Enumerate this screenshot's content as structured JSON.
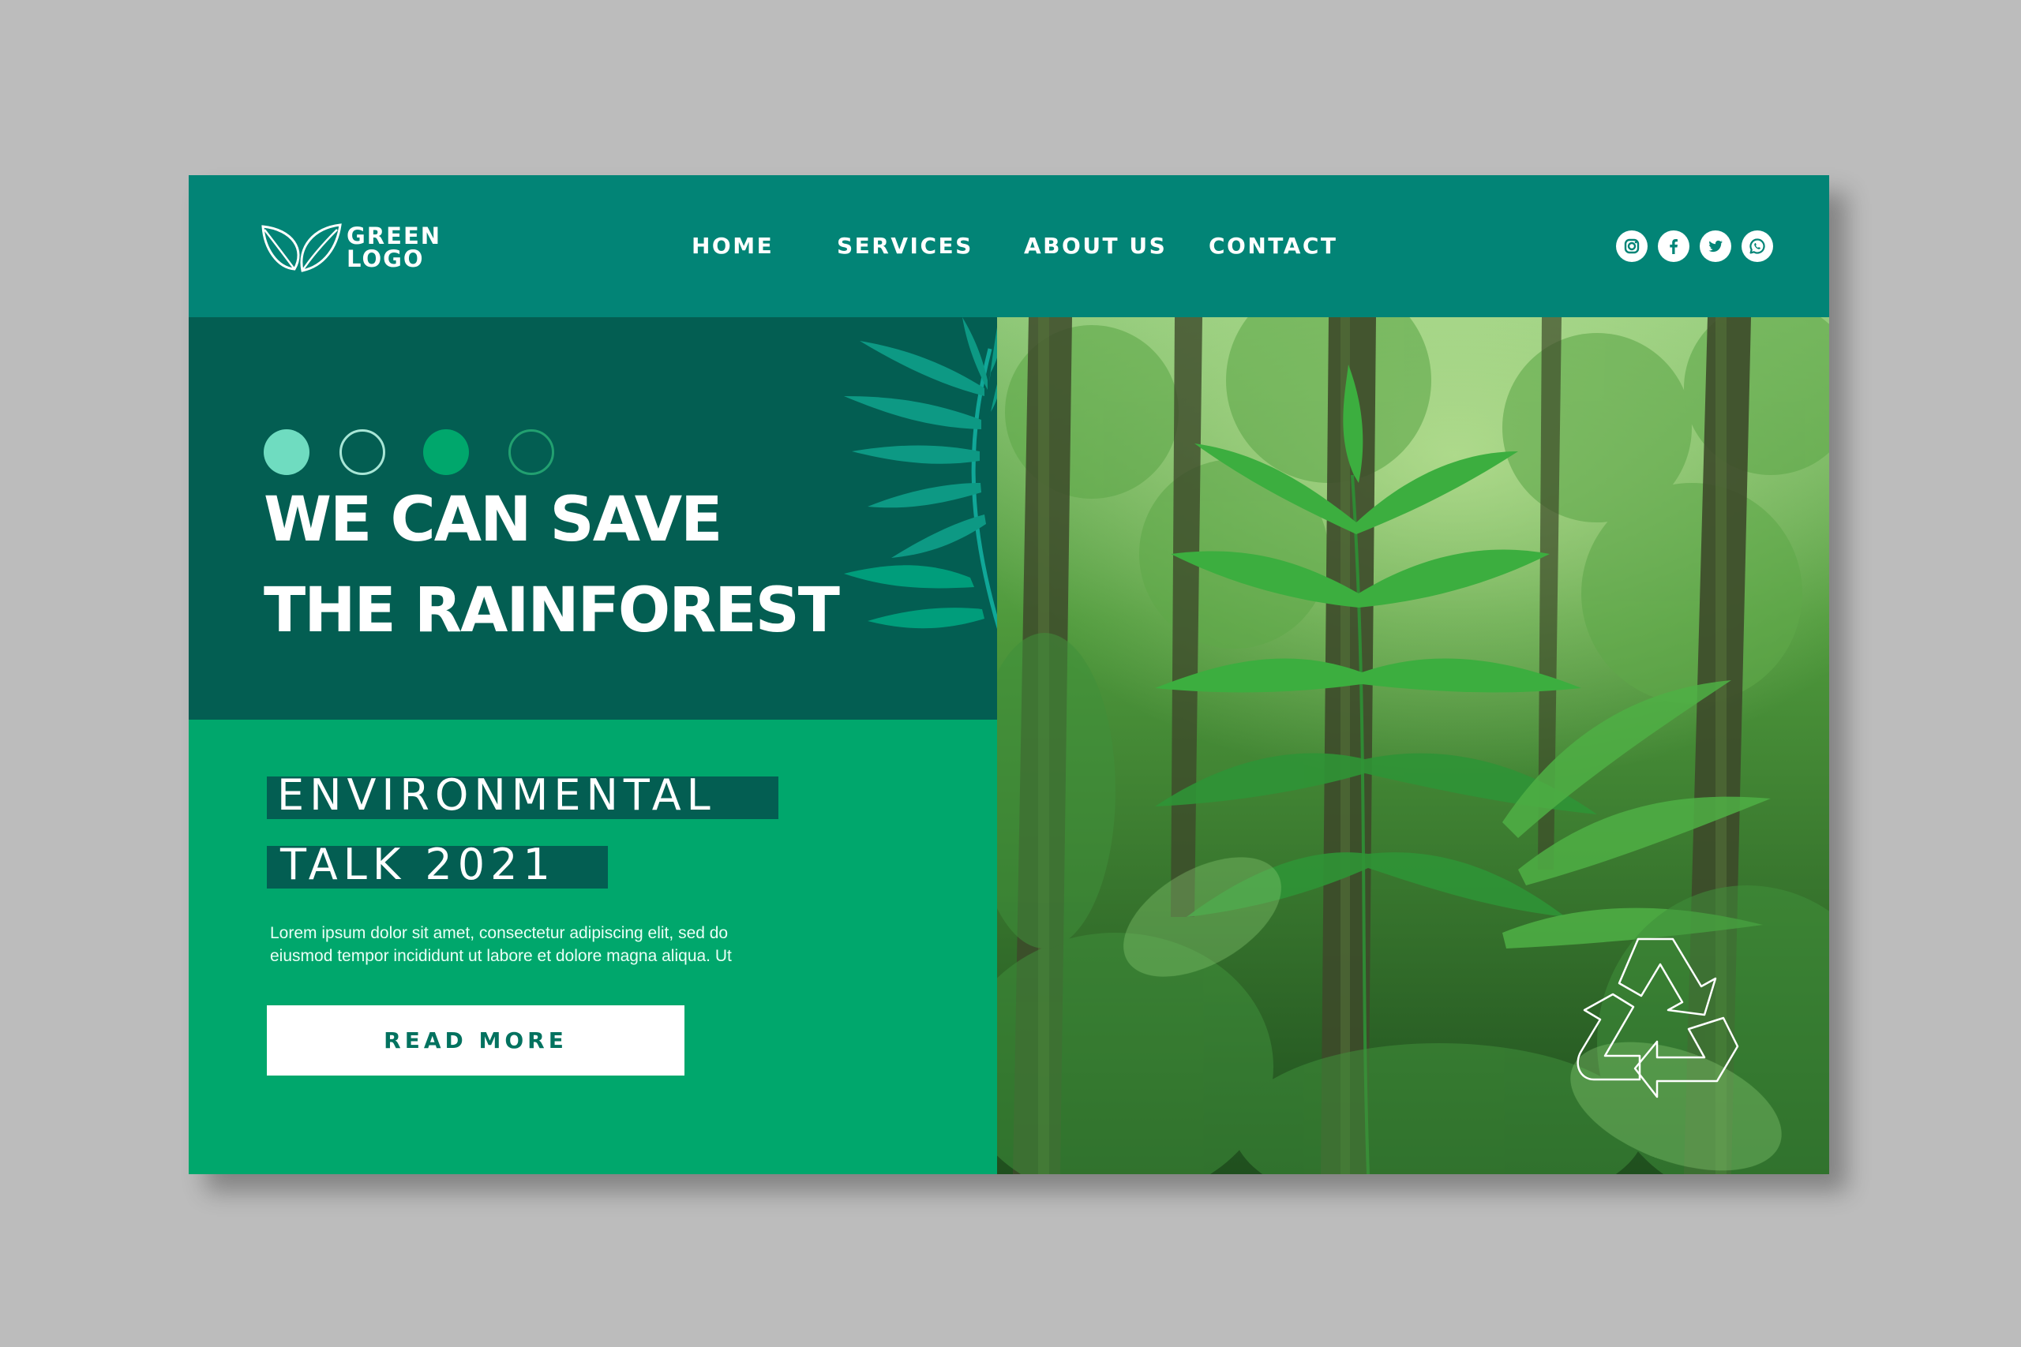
{
  "header": {
    "logo": {
      "line1": "GREEN",
      "line2": "LOGO"
    },
    "nav": [
      {
        "label": "HOME"
      },
      {
        "label": "SERVICES"
      },
      {
        "label": "ABOUT US"
      },
      {
        "label": "CONTACT"
      }
    ],
    "social": [
      {
        "icon": "instagram-icon"
      },
      {
        "icon": "facebook-icon"
      },
      {
        "icon": "twitter-icon"
      },
      {
        "icon": "whatsapp-icon"
      }
    ]
  },
  "hero": {
    "slider_dots": [
      {
        "style": "filled",
        "color": "#6fdcc0"
      },
      {
        "style": "outline",
        "color": "#a8e6d6"
      },
      {
        "style": "filled",
        "color": "#00a76c"
      },
      {
        "style": "outline",
        "color": "#22a070"
      }
    ],
    "title_line1": "WE CAN SAVE",
    "title_line2": "THE RAINFOREST"
  },
  "event": {
    "tag_line1": "ENVIRONMENTAL",
    "tag_line2": "TALK 2021",
    "body_line1": "Lorem ipsum dolor sit amet, consectetur adipiscing elit, sed do",
    "body_line2": "eiusmod tempor incididunt ut labore et dolore magna aliqua. Ut",
    "cta_label": "READ MORE"
  },
  "image": {
    "subject": "rainforest-photo",
    "overlay_icon": "recycle-icon"
  },
  "colors": {
    "header": "#028476",
    "hero_dark": "#035e52",
    "hero_light": "#00a76c",
    "accent_mint": "#6fdcc0",
    "cta_text": "#03725f",
    "page_bg": "#bcbcbc"
  }
}
